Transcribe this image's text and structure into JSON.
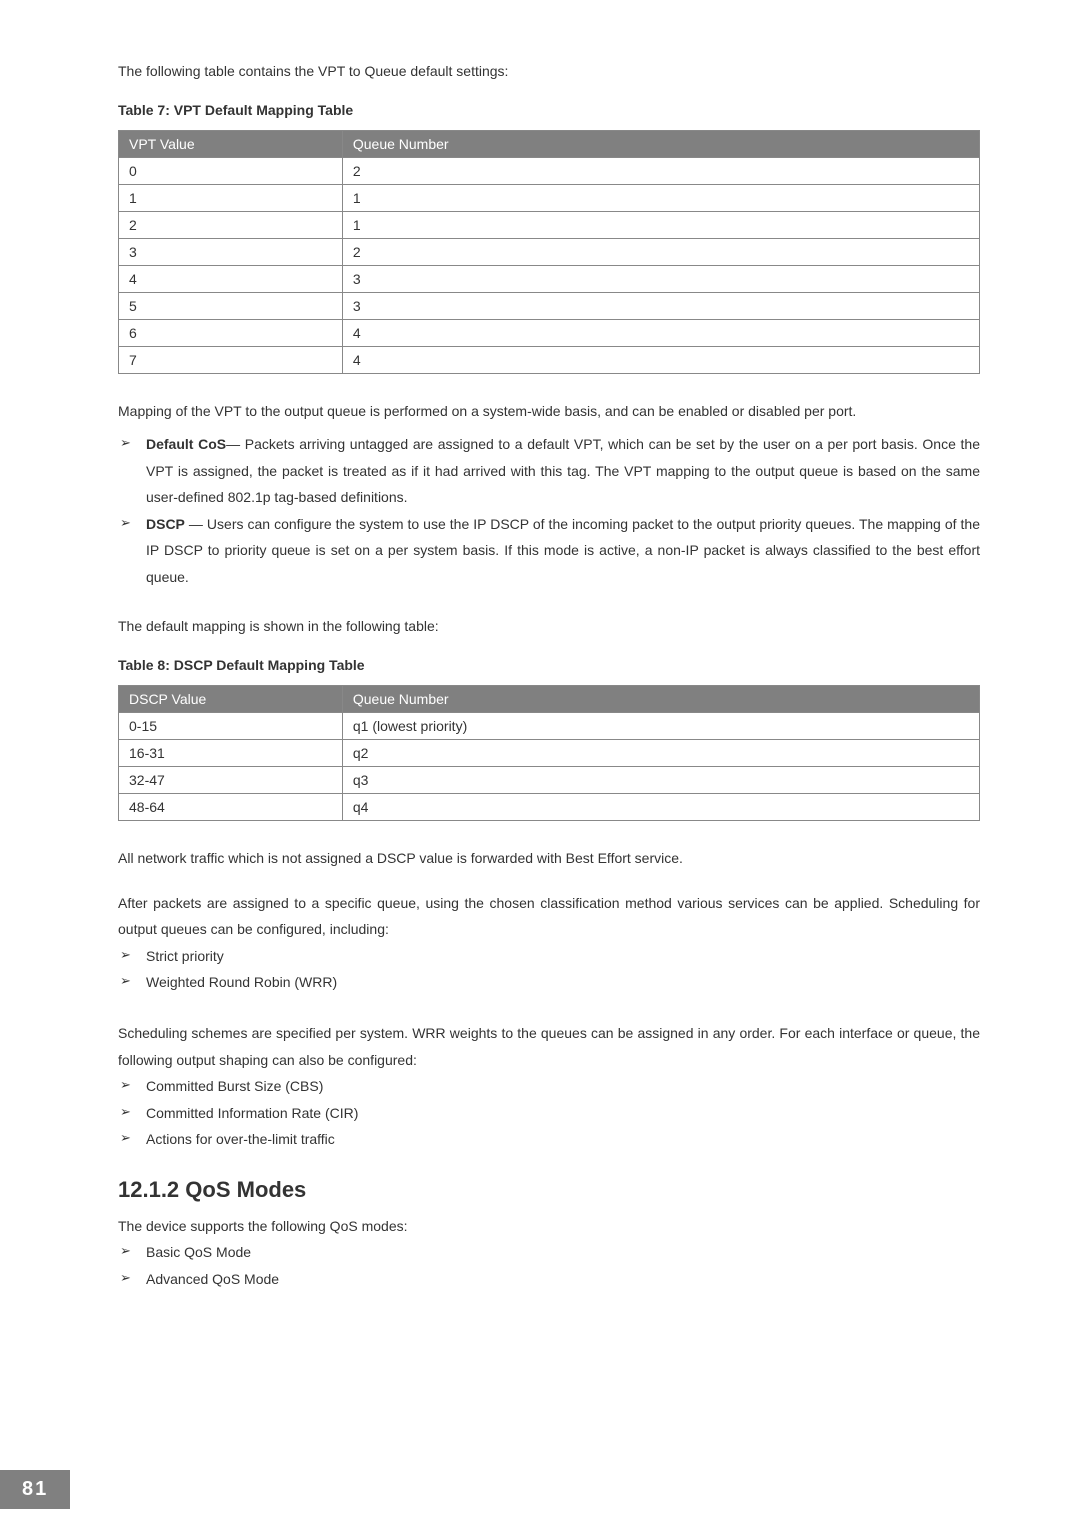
{
  "intro1": "The following table contains the VPT to Queue default settings:",
  "table7": {
    "caption": "Table 7: VPT Default Mapping Table",
    "headers": [
      "VPT Value",
      "Queue Number"
    ],
    "rows": [
      [
        "0",
        "2"
      ],
      [
        "1",
        "1"
      ],
      [
        "2",
        "1"
      ],
      [
        "3",
        "2"
      ],
      [
        "4",
        "3"
      ],
      [
        "5",
        "3"
      ],
      [
        "6",
        "4"
      ],
      [
        "7",
        "4"
      ]
    ]
  },
  "mapping_intro": "Mapping of the VPT to the output queue is performed on a system-wide basis, and can be enabled or disabled per port.",
  "bullets1": [
    {
      "bold": "Default CoS",
      "text": "— Packets arriving untagged are assigned to a default VPT, which can be set by the user on a per port basis. Once the VPT is assigned, the packet is treated as if it had arrived with this tag. The VPT mapping to the output queue is based on the same user-defined 802.1p tag-based definitions."
    },
    {
      "bold": "DSCP",
      "text": " — Users can configure the system to use the IP DSCP of the incoming packet to the output priority queues. The mapping of the IP DSCP to priority queue is set on a per system basis. If this mode is active, a non-IP packet is always classified to the best effort queue."
    }
  ],
  "default_mapping_intro": "The default mapping is shown in the following table:",
  "table8": {
    "caption": "Table 8: DSCP Default Mapping Table",
    "headers": [
      "DSCP Value",
      "Queue Number"
    ],
    "rows": [
      [
        "0-15",
        "q1 (lowest priority)"
      ],
      [
        "16-31",
        "q2"
      ],
      [
        "32-47",
        "q3"
      ],
      [
        "48-64",
        "q4"
      ]
    ]
  },
  "para2": "All network traffic which is not assigned a DSCP value is forwarded with Best Effort service.",
  "para3": "After packets are assigned to a specific queue, using the chosen classification method various services can be applied. Scheduling for output queues can be configured, including:",
  "bullets2": [
    "Strict priority",
    "Weighted Round Robin (WRR)"
  ],
  "para4": "Scheduling schemes are specified per system. WRR weights to the queues can be assigned in any order. For each interface or queue, the following output shaping can also be configured:",
  "bullets3": [
    "Committed Burst Size (CBS)",
    "Committed Information Rate (CIR)",
    "Actions for over-the-limit traffic"
  ],
  "section_heading": "12.1.2   QoS Modes",
  "para5": "The device supports the following QoS modes:",
  "bullets4": [
    "Basic QoS Mode",
    "Advanced QoS Mode"
  ],
  "page_number": "81"
}
